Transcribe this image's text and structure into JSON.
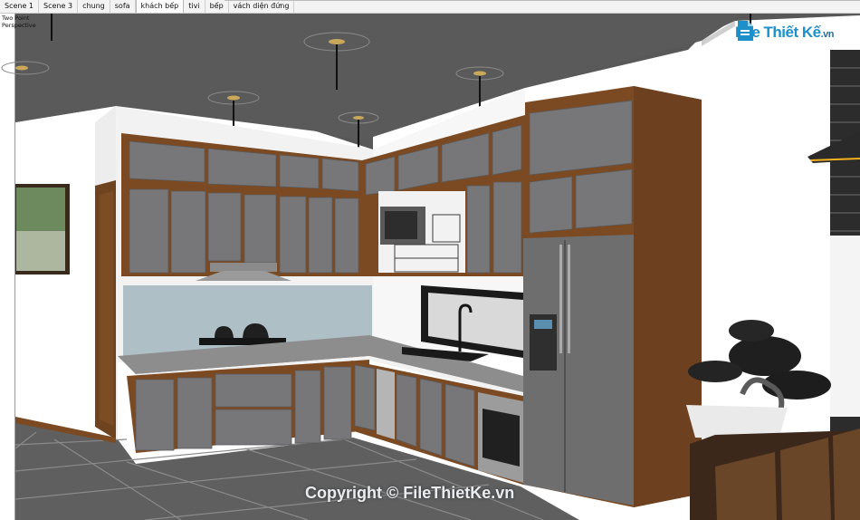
{
  "tabs": [
    {
      "label": "Scene 1",
      "active": false
    },
    {
      "label": "Scene 3",
      "active": false
    },
    {
      "label": "chung",
      "active": false
    },
    {
      "label": "sofa",
      "active": false
    },
    {
      "label": "khách bếp",
      "active": true
    },
    {
      "label": "tivi",
      "active": false
    },
    {
      "label": "bếp",
      "active": false
    },
    {
      "label": "vách diện đứng",
      "active": false
    }
  ],
  "viewport": {
    "camera_label": "Two Point Perspective"
  },
  "watermark": {
    "logo_main": "File Thiết Kế",
    "logo_tld": ".vn",
    "copyright": "Copyright © FileThietKe.vn"
  },
  "colors": {
    "ceiling": "#575757",
    "cabinet_door": "#777679",
    "cabinet_frame": "#7b4a23",
    "backsplash": "#aebfc6",
    "floor_tile": "#5e5e5e",
    "countertop": "#8d8d8d",
    "fridge": "#6e6e6e",
    "logo_blue": "#1d8fc9"
  },
  "icons": [
    "logo-icon"
  ]
}
